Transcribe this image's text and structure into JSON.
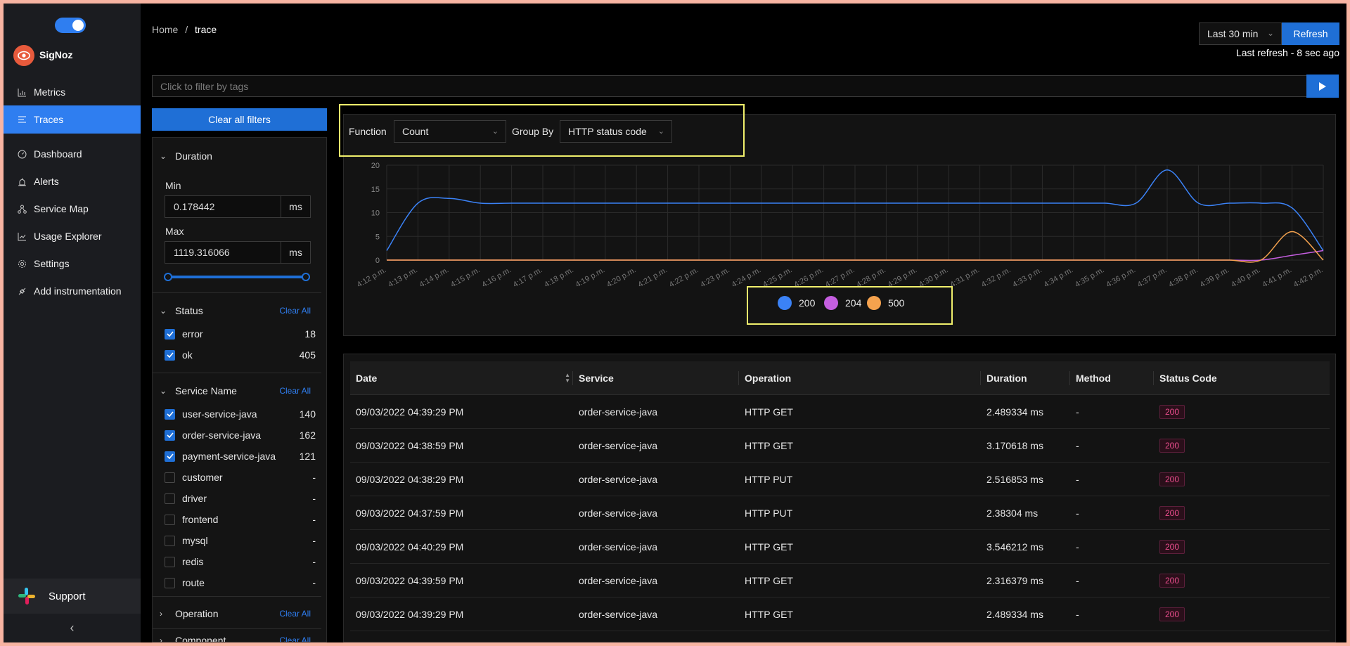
{
  "sidebar": {
    "brand": "SigNoz",
    "items": [
      {
        "label": "Metrics",
        "icon": "bar-chart-icon"
      },
      {
        "label": "Traces",
        "icon": "list-icon"
      },
      {
        "label": "Dashboard",
        "icon": "dashboard-icon"
      },
      {
        "label": "Alerts",
        "icon": "alarm-icon"
      },
      {
        "label": "Service Map",
        "icon": "deployment-icon"
      },
      {
        "label": "Usage Explorer",
        "icon": "line-chart-icon"
      },
      {
        "label": "Settings",
        "icon": "gear-icon"
      },
      {
        "label": "Add instrumentation",
        "icon": "api-icon"
      }
    ],
    "active": "Traces",
    "support": "Support"
  },
  "breadcrumb": {
    "home": "Home",
    "sep": "/",
    "current": "trace"
  },
  "header": {
    "time_range": "Last 30 min",
    "refresh": "Refresh",
    "last_refresh": "Last refresh - 8 sec ago"
  },
  "filter_bar": {
    "placeholder": "Click to filter by tags"
  },
  "filters": {
    "clear_all_filters": "Clear all filters",
    "duration": {
      "title": "Duration",
      "min_label": "Min",
      "min_value": "0.178442",
      "max_label": "Max",
      "max_value": "1119.316066",
      "unit": "ms",
      "range_fraction": [
        0,
        1
      ]
    },
    "status": {
      "title": "Status",
      "clear": "Clear All",
      "items": [
        {
          "label": "error",
          "count": "18",
          "checked": true
        },
        {
          "label": "ok",
          "count": "405",
          "checked": true
        }
      ]
    },
    "service_name": {
      "title": "Service Name",
      "clear": "Clear All",
      "items": [
        {
          "label": "user-service-java",
          "count": "140",
          "checked": true
        },
        {
          "label": "order-service-java",
          "count": "162",
          "checked": true
        },
        {
          "label": "payment-service-java",
          "count": "121",
          "checked": true
        },
        {
          "label": "customer",
          "count": "-",
          "checked": false
        },
        {
          "label": "driver",
          "count": "-",
          "checked": false
        },
        {
          "label": "frontend",
          "count": "-",
          "checked": false
        },
        {
          "label": "mysql",
          "count": "-",
          "checked": false
        },
        {
          "label": "redis",
          "count": "-",
          "checked": false
        },
        {
          "label": "route",
          "count": "-",
          "checked": false
        }
      ]
    },
    "operation": {
      "title": "Operation",
      "clear": "Clear All"
    },
    "component": {
      "title": "Component",
      "clear": "Clear All"
    }
  },
  "controls": {
    "function_label": "Function",
    "function_value": "Count",
    "group_by_label": "Group By",
    "group_by_value": "HTTP status code"
  },
  "chart_data": {
    "type": "line",
    "x": [
      "4:12 p.m.",
      "4:13 p.m.",
      "4:14 p.m.",
      "4:15 p.m.",
      "4:16 p.m.",
      "4:17 p.m.",
      "4:18 p.m.",
      "4:19 p.m.",
      "4:20 p.m.",
      "4:21 p.m.",
      "4:22 p.m.",
      "4:23 p.m.",
      "4:24 p.m.",
      "4:25 p.m.",
      "4:26 p.m.",
      "4:27 p.m.",
      "4:28 p.m.",
      "4:29 p.m.",
      "4:30 p.m.",
      "4:31 p.m.",
      "4:32 p.m.",
      "4:33 p.m.",
      "4:34 p.m.",
      "4:35 p.m.",
      "4:36 p.m.",
      "4:37 p.m.",
      "4:38 p.m.",
      "4:39 p.m.",
      "4:40 p.m.",
      "4:41 p.m.",
      "4:42 p.m."
    ],
    "series": [
      {
        "name": "200",
        "color": "#3b82f6",
        "values": [
          2,
          12,
          13,
          12,
          12,
          12,
          12,
          12,
          12,
          12,
          12,
          12,
          12,
          12,
          12,
          12,
          12,
          12,
          12,
          12,
          12,
          12,
          12,
          12,
          12,
          19,
          12,
          12,
          12,
          11,
          2
        ]
      },
      {
        "name": "204",
        "color": "#c55ee0",
        "values": [
          0,
          0,
          0,
          0,
          0,
          0,
          0,
          0,
          0,
          0,
          0,
          0,
          0,
          0,
          0,
          0,
          0,
          0,
          0,
          0,
          0,
          0,
          0,
          0,
          0,
          0,
          0,
          0,
          0,
          1,
          2
        ]
      },
      {
        "name": "500",
        "color": "#f5a24e",
        "values": [
          0,
          0,
          0,
          0,
          0,
          0,
          0,
          0,
          0,
          0,
          0,
          0,
          0,
          0,
          0,
          0,
          0,
          0,
          0,
          0,
          0,
          0,
          0,
          0,
          0,
          0,
          0,
          0,
          0,
          6,
          0
        ]
      }
    ],
    "yticks": [
      "0",
      "5",
      "10",
      "15",
      "20"
    ],
    "ylim": [
      0,
      20
    ],
    "grid": true,
    "legend": "bottom-center"
  },
  "table": {
    "columns": [
      "Date",
      "Service",
      "Operation",
      "Duration",
      "Method",
      "Status Code"
    ],
    "rows": [
      [
        "09/03/2022 04:39:29 PM",
        "order-service-java",
        "HTTP GET",
        "2.489334 ms",
        "-",
        "200"
      ],
      [
        "09/03/2022 04:38:59 PM",
        "order-service-java",
        "HTTP GET",
        "3.170618 ms",
        "-",
        "200"
      ],
      [
        "09/03/2022 04:38:29 PM",
        "order-service-java",
        "HTTP PUT",
        "2.516853 ms",
        "-",
        "200"
      ],
      [
        "09/03/2022 04:37:59 PM",
        "order-service-java",
        "HTTP PUT",
        "2.38304 ms",
        "-",
        "200"
      ],
      [
        "09/03/2022 04:40:29 PM",
        "order-service-java",
        "HTTP GET",
        "3.546212 ms",
        "-",
        "200"
      ],
      [
        "09/03/2022 04:39:59 PM",
        "order-service-java",
        "HTTP GET",
        "2.316379 ms",
        "-",
        "200"
      ],
      [
        "09/03/2022 04:39:29 PM",
        "order-service-java",
        "HTTP GET",
        "2.489334 ms",
        "-",
        "200"
      ]
    ]
  }
}
